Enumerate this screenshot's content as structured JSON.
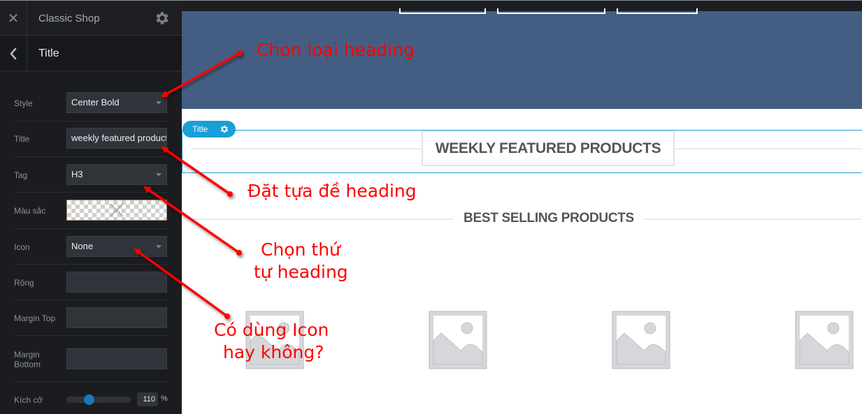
{
  "sidebar": {
    "close_icon": "close-icon",
    "shop_name": "Classic Shop",
    "settings_icon": "gear-icon",
    "back_icon": "chevron-left-icon",
    "panel_title": "Title",
    "fields": {
      "style": {
        "label": "Style",
        "value": "Center Bold"
      },
      "title": {
        "label": "Title",
        "value": "weekly featured products"
      },
      "tag": {
        "label": "Tag",
        "value": "H3"
      },
      "color": {
        "label": "Màu sắc",
        "value": "transparent"
      },
      "icon": {
        "label": "Icon",
        "value": "None"
      },
      "width": {
        "label": "Rộng",
        "value": ""
      },
      "margin_top": {
        "label": "Margin Top",
        "value": ""
      },
      "margin_bottom": {
        "label": "Margin Bottom",
        "value": ""
      },
      "size": {
        "label": "Kích cỡ",
        "value": "110",
        "unit": "%",
        "slider_fraction": 0.35
      }
    }
  },
  "canvas": {
    "title_tag": {
      "label": "Title",
      "icon": "gear-icon"
    },
    "featured_heading": "WEEKLY FEATURED PRODUCTS",
    "bestselling_heading": "BEST SELLING PRODUCTS",
    "product_placeholders": 4
  },
  "annotations": {
    "style": "Chọn loại heading",
    "title": "Đặt tựa đề heading",
    "tag_line1": "Chọn thứ",
    "tag_line2": "tự heading",
    "icon_line1": "Có dùng Icon",
    "icon_line2": "hay không?"
  },
  "colors": {
    "accent": "#1a9fd6",
    "hero_bg": "#445e83",
    "sidebar_bg": "#1a1c20",
    "annotation": "#ff0000"
  }
}
